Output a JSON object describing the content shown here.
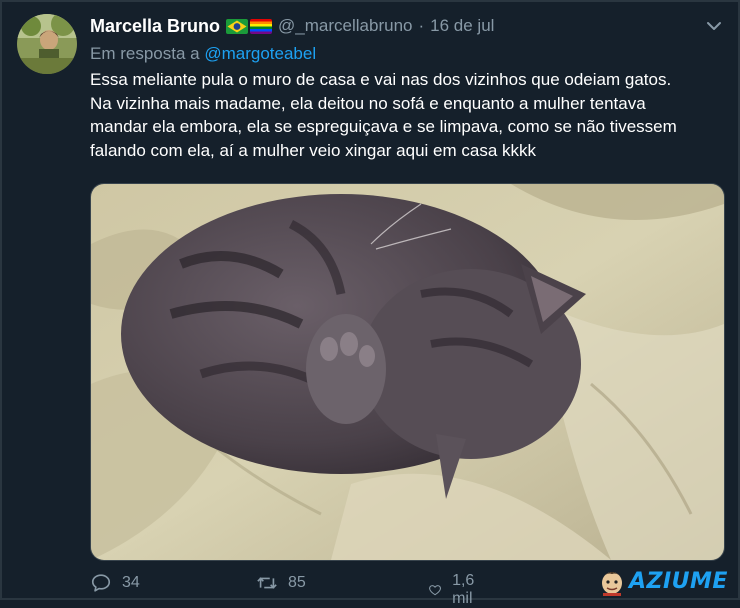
{
  "tweet": {
    "author_name": "Marcella Bruno",
    "handle": "@_marcellabruno",
    "separator": "·",
    "date": "16 de jul",
    "reply_prefix": "Em resposta a",
    "reply_mention": "@margoteabel",
    "text_lines": [
      "Essa meliante pula o muro de casa e vai nas dos vizinhos que odeiam gatos.",
      "Na vizinha mais madame, ela deitou no sofá e enquanto a mulher tentava",
      "mandar ela embora, ela se espreguiçava e se limpava, como se não tivessem",
      "falando com ela, aí a mulher veio xingar aqui em casa kkkk"
    ],
    "flags": [
      "brazil-flag-icon",
      "rainbow-flag-icon"
    ],
    "media_description": "photo of a gray tabby cat curled up on a beige blanket covering its face with its paw"
  },
  "actions": {
    "reply_count": "34",
    "retweet_count": "85",
    "like_count": "1,6 mil"
  },
  "watermark": {
    "text": "AZIUME"
  },
  "colors": {
    "background": "#15202b",
    "secondary_text": "#8899a6",
    "link": "#1da1f2",
    "border": "#38444d"
  }
}
